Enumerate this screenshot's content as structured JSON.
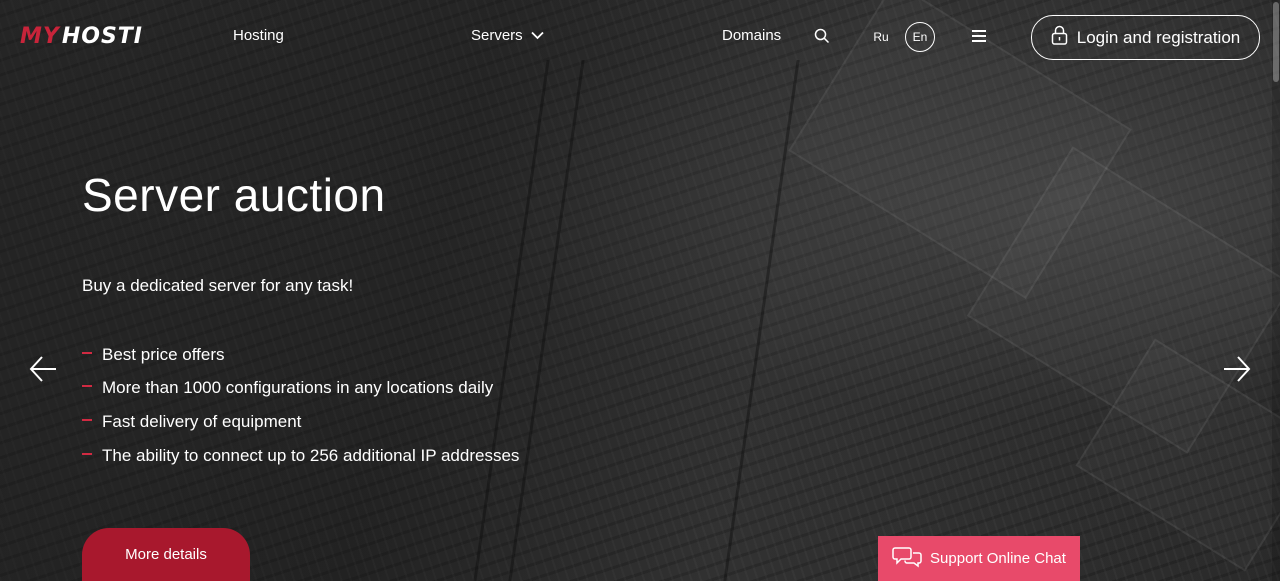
{
  "logo": {
    "part1": "MY",
    "part2": "HOSTI"
  },
  "nav": {
    "hosting": "Hosting",
    "servers": "Servers",
    "domains": "Domains",
    "lang_ru": "Ru",
    "lang_en": "En",
    "login": "Login and registration"
  },
  "hero": {
    "title": "Server auction",
    "subtitle": "Buy a dedicated server for any task!",
    "features": [
      "Best price offers",
      "More than 1000 configurations in any locations daily",
      "Fast delivery of equipment",
      "The ability to connect up to 256 additional IP addresses"
    ],
    "cta": "More details"
  },
  "chat": {
    "label": "Support Online Chat"
  },
  "colors": {
    "accent": "#a8182d",
    "brand_red": "#c8243a",
    "chat": "#e84a6a"
  },
  "icons": {
    "nav_dropdown": "chevron-down-icon",
    "search": "search-icon",
    "menu": "hamburger-icon",
    "login": "lock-icon",
    "prev": "arrow-left-icon",
    "next": "arrow-right-icon",
    "chat": "chat-bubbles-icon"
  }
}
